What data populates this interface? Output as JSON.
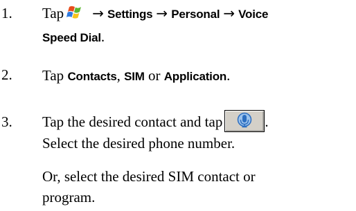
{
  "steps": [
    {
      "number": "1.",
      "tap_word": "Tap",
      "start_icon": "windows-start-icon",
      "arrow_char": "→",
      "path": [
        "Settings",
        "Personal",
        "Voice"
      ],
      "path_continued": "Speed Dial",
      "end": "."
    },
    {
      "number": "2.",
      "tap_word": "Tap",
      "option1": "Contacts",
      "sep1": ",",
      "option2": "SIM",
      "or_word": "or",
      "option3": "Application",
      "end": "."
    },
    {
      "number": "3.",
      "text_a": "Tap the desired contact and tap",
      "button_icon": "microphone-button-icon",
      "end": ".",
      "text_b": "Select the desired phone number.",
      "text_c": "Or, select the desired SIM contact or",
      "text_d": "program."
    }
  ],
  "colors": {
    "text": "#000000",
    "button_fill": "#d4d0c8",
    "mic_blue": "#2c6ec0"
  }
}
